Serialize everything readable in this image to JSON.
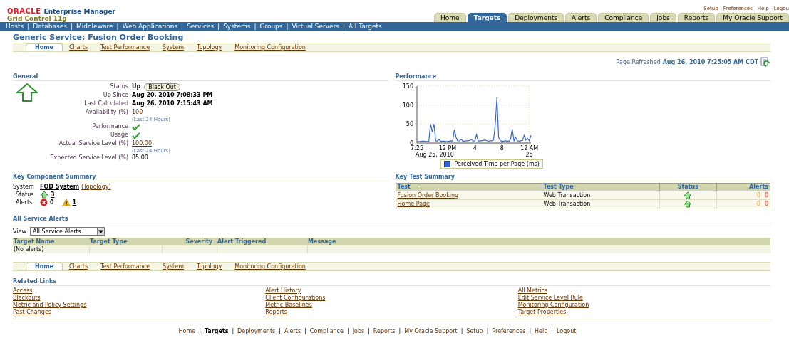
{
  "header": {
    "brand": "ORACLE",
    "product": "Enterprise Manager",
    "edition": "Grid Control 11g"
  },
  "global_links": [
    "Setup",
    "Preferences",
    "Help",
    "Logou"
  ],
  "tabs": [
    {
      "label": "Home",
      "selected": false
    },
    {
      "label": "Targets",
      "selected": true
    },
    {
      "label": "Deployments",
      "selected": false
    },
    {
      "label": "Alerts",
      "selected": false
    },
    {
      "label": "Compliance",
      "selected": false
    },
    {
      "label": "Jobs",
      "selected": false
    },
    {
      "label": "Reports",
      "selected": false
    },
    {
      "label": "My Oracle Support",
      "selected": false
    }
  ],
  "subnav_separator": "|",
  "subnav": [
    "Hosts",
    "Databases",
    "Middleware",
    "Web Applications",
    "Services",
    "Systems",
    "Groups",
    "Virtual Servers",
    "All Targets"
  ],
  "page_title": "Generic Service: Fusion Order Booking",
  "subtabs": [
    {
      "label": "Home",
      "selected": true
    },
    {
      "label": "Charts",
      "selected": false
    },
    {
      "label": "Test Performance",
      "selected": false
    },
    {
      "label": "System",
      "selected": false
    },
    {
      "label": "Topology",
      "selected": false
    },
    {
      "label": "Monitoring Configuration",
      "selected": false
    }
  ],
  "refreshed": {
    "label": "Page Refreshed",
    "value": "Aug 26, 2010 7:25:05 AM CDT"
  },
  "general": {
    "title": "General",
    "rows": [
      {
        "label": "Status",
        "kind": "status",
        "value": "Up",
        "button": "Black Out"
      },
      {
        "label": "Up Since",
        "kind": "bold",
        "value": "Aug 20, 2010 7:08:33 PM"
      },
      {
        "label": "Last Calculated",
        "kind": "bold",
        "value": "Aug 26, 2010 7:15:43 AM"
      },
      {
        "label": "Availability (%)",
        "kind": "link",
        "value": "100",
        "note": "(Last 24 Hours)"
      },
      {
        "label": "Performance",
        "kind": "check"
      },
      {
        "label": "Usage",
        "kind": "check"
      },
      {
        "label": "Actual Service Level (%)",
        "kind": "link",
        "value": "100.00",
        "note": "(Last 24 Hours)"
      },
      {
        "label": "Expected Service Level (%)",
        "kind": "text",
        "value": "85.00"
      }
    ]
  },
  "performance": {
    "title": "Performance",
    "date_start": "Aug 25, 2010",
    "date_end": "26",
    "chart_data": {
      "type": "line",
      "ylim": [
        0,
        150
      ],
      "yticks": [
        0,
        50,
        100,
        150
      ],
      "categories": [
        "7:25",
        null,
        null,
        null,
        null,
        null,
        null,
        null,
        null,
        null,
        null,
        null,
        null,
        null,
        null,
        null,
        null,
        null,
        "12 PM",
        null,
        null,
        null,
        null,
        null,
        null,
        null,
        null,
        null,
        null,
        null,
        null,
        null,
        null,
        null,
        "4",
        null,
        null,
        null,
        null,
        null,
        null,
        null,
        null,
        null,
        null,
        null,
        null,
        null,
        null,
        null,
        "8",
        null,
        null,
        null,
        null,
        null,
        null,
        null,
        null,
        null,
        null,
        null,
        null,
        null,
        null,
        null,
        "12 AM",
        null
      ],
      "series": [
        {
          "name": "Perceived Time per Page (ms)",
          "color": "#3366cc",
          "values": [
            3,
            4,
            4,
            5,
            5,
            4,
            4,
            5,
            50,
            30,
            50,
            6,
            5,
            10,
            4,
            5,
            5,
            4,
            4,
            5,
            6,
            5,
            35,
            15,
            5,
            6,
            10,
            5,
            5,
            6,
            6,
            7,
            10,
            5,
            6,
            22,
            5,
            6,
            6,
            7,
            8,
            6,
            5,
            6,
            6,
            8,
            50,
            120,
            15,
            6,
            5,
            5,
            6,
            5,
            5,
            10,
            37,
            6,
            15,
            6,
            5,
            6,
            7,
            20,
            8,
            12,
            6,
            20
          ]
        }
      ]
    }
  },
  "key_component": {
    "title": "Key Component Summary",
    "system_label": "System",
    "system": "FOD System",
    "topology": "(Topology)",
    "status_label": "Status",
    "status_count": "3",
    "alerts_label": "Alerts",
    "critical": "0",
    "warning": "1"
  },
  "key_test": {
    "title": "Key Test Summary",
    "columns": [
      "Test",
      "Test Type",
      "Status",
      "Alerts"
    ],
    "rows": [
      {
        "test": "Fusion Order Booking",
        "type": "Web Transaction",
        "up": true,
        "warnings": "0",
        "criticals": "0"
      },
      {
        "test": "Home Page",
        "type": "Web Transaction",
        "up": true,
        "warnings": "0",
        "criticals": "0"
      }
    ]
  },
  "service_alerts": {
    "title": "All Service Alerts",
    "view_label": "View",
    "view": "All Service Alerts",
    "columns": [
      "Target Name",
      "Target Type",
      "Severity",
      "Alert Triggered",
      "Message"
    ],
    "empty": "(No alerts)"
  },
  "bottom_subtabs": [
    {
      "label": "Home",
      "selected": true
    },
    {
      "label": "Charts",
      "selected": false
    },
    {
      "label": "Test Performance",
      "selected": false
    },
    {
      "label": "System",
      "selected": false
    },
    {
      "label": "Topology",
      "selected": false
    },
    {
      "label": "Monitoring Configuration",
      "selected": false
    }
  ],
  "related_links": {
    "title": "Related Links",
    "columns": [
      [
        "Access",
        "Blackouts",
        "Metric and Policy Settings",
        "Past Changes"
      ],
      [
        "Alert History",
        "Client Configurations",
        "Metric Baselines",
        "Reports"
      ],
      [
        "All Metrics",
        "Edit Service Level Rule",
        "Monitoring Configuration",
        "Target Properties"
      ]
    ]
  },
  "footer_separator": "|",
  "footer_links": [
    {
      "label": "Home",
      "selected": false
    },
    {
      "label": "Targets",
      "selected": true
    },
    {
      "label": "Deployments",
      "selected": false
    },
    {
      "label": "Alerts",
      "selected": false
    },
    {
      "label": "Compliance",
      "selected": false
    },
    {
      "label": "Jobs",
      "selected": false
    },
    {
      "label": "Reports",
      "selected": false
    },
    {
      "label": "My Oracle Support",
      "selected": false
    },
    {
      "label": "Setup",
      "selected": false
    },
    {
      "label": "Preferences",
      "selected": false
    },
    {
      "label": "Help",
      "selected": false
    },
    {
      "label": "Logout",
      "selected": false
    }
  ]
}
